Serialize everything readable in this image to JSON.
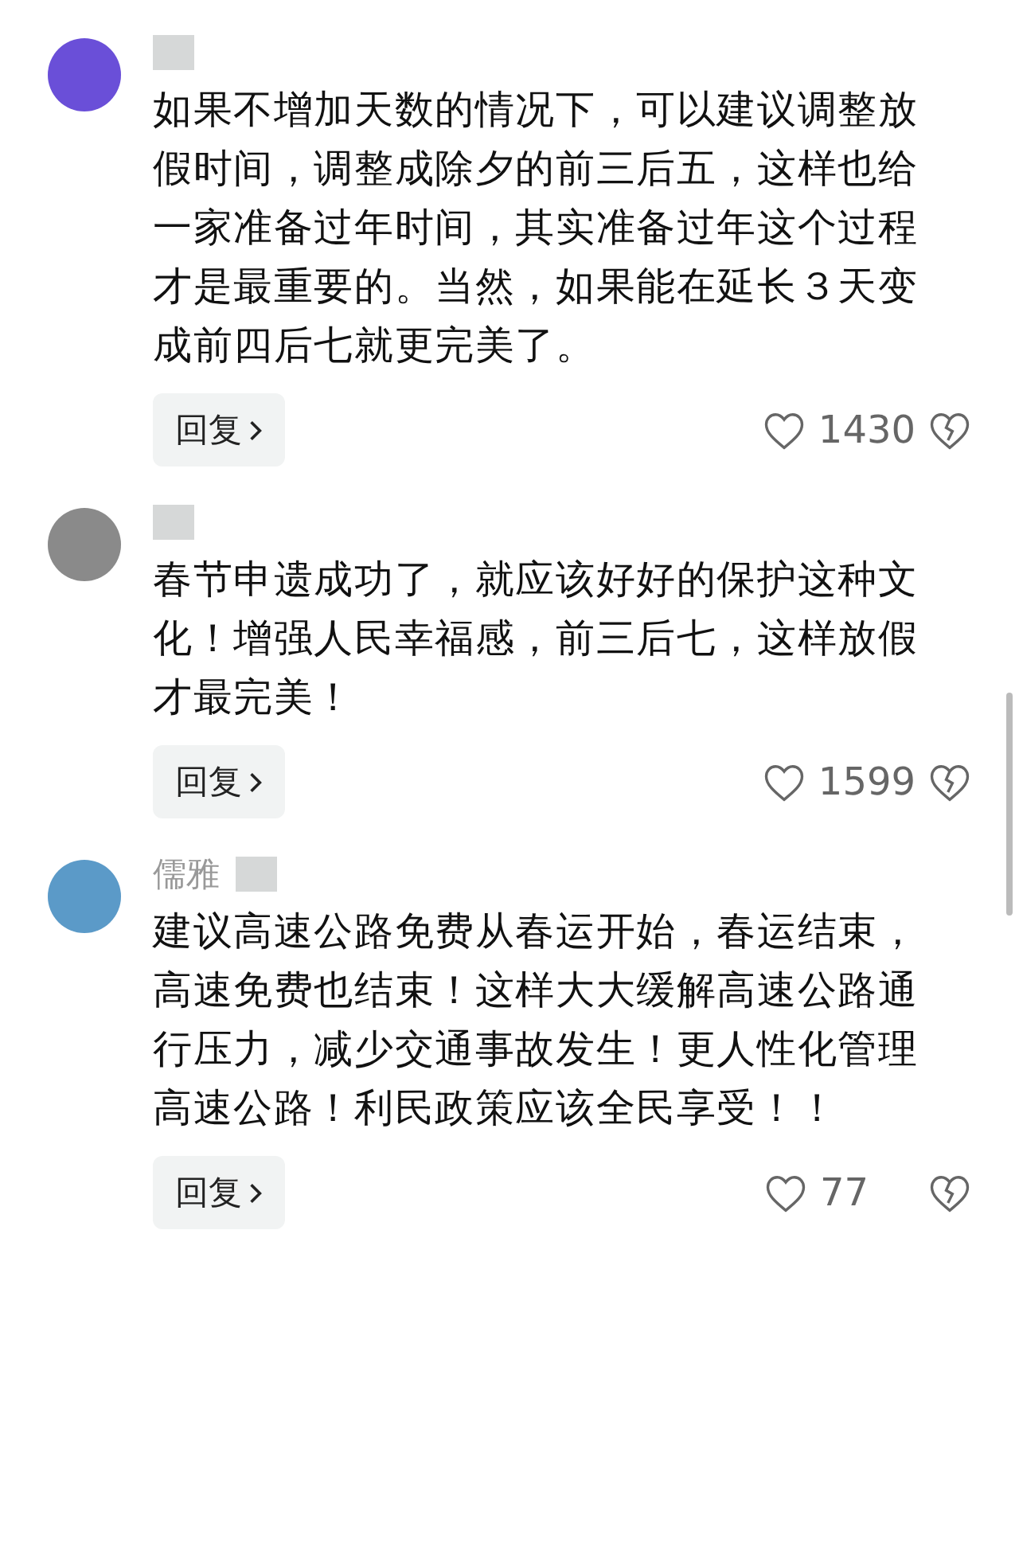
{
  "comments": [
    {
      "text": "如果不增加天数的情况下，可以建议调整放假时间，调整成除夕的前三后五，这样也给一家准备过年时间，其实准备过年这个过程才是最重要的。当然，如果能在延长３天变成前四后七就更完美了。",
      "reply": "回复",
      "likes": "1430"
    },
    {
      "text": "春节申遗成功了，就应该好好的保护这种文化！增强人民幸福感，前三后七，这样放假才最完美！",
      "reply": "回复",
      "likes": "1599"
    },
    {
      "author": "儒雅",
      "text": "建议高速公路免费从春运开始，春运结束，高速免费也结束！这样大大缓解高速公路通行压力，减少交通事故发生！更人性化管理高速公路！利民政策应该全民享受！！",
      "reply": "回复",
      "likes": "77"
    }
  ]
}
